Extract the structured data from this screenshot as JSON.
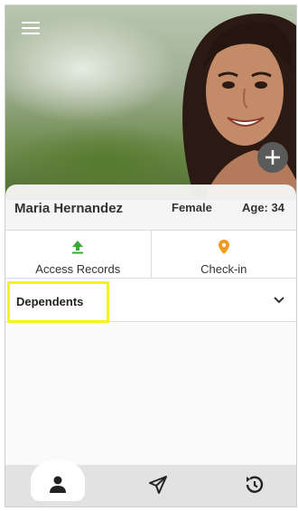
{
  "profile": {
    "name": "Maria Hernandez",
    "gender": "Female",
    "age": "Age: 34"
  },
  "actions": {
    "access_records": "Access Records",
    "check_in": "Check-in"
  },
  "dependents": {
    "label": "Dependents"
  },
  "colors": {
    "accent_green": "#3aa83a",
    "accent_orange": "#f29a1e",
    "highlight": "#f4f417",
    "nav_bg": "#e2e2e2"
  },
  "icons": {
    "menu": "hamburger-menu-icon",
    "add": "plus-icon",
    "access": "upload-arrow-icon",
    "checkin": "location-pin-icon",
    "expand": "chevron-down-icon",
    "profile_tab": "person-icon",
    "send_tab": "paper-plane-icon",
    "history_tab": "history-icon"
  }
}
